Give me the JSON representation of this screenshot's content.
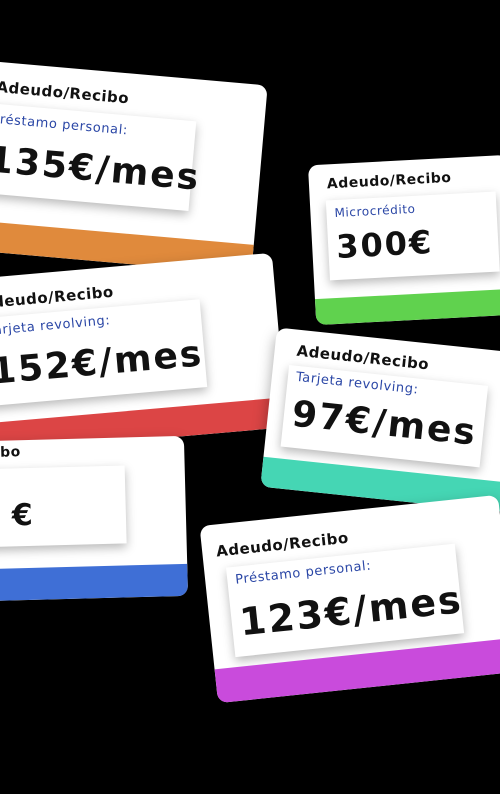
{
  "cards": [
    {
      "header": "Adeudo/Recibo",
      "label": "Préstamo personal:",
      "amount": "135€/mes",
      "band_color": "#e08a3c"
    },
    {
      "header": "Adeudo/Recibo",
      "label": "Microcrédito",
      "amount": "300€",
      "band_color": "#60d24e"
    },
    {
      "header": "Adeudo/Recibo",
      "label": "Tarjeta revolving:",
      "amount": "152€/mes",
      "band_color": "#dc4545"
    },
    {
      "header": "Adeudo/Recibo",
      "label": "Tarjeta revolving:",
      "amount": "97€/mes",
      "band_color": "#45d6b4"
    },
    {
      "header": "Adeudo/Recibo",
      "label": "",
      "amount": "€",
      "band_color": "#3f6fd6"
    },
    {
      "header": "Adeudo/Recibo",
      "label": "Préstamo personal:",
      "amount": "123€/mes",
      "band_color": "#c94bdc"
    }
  ]
}
